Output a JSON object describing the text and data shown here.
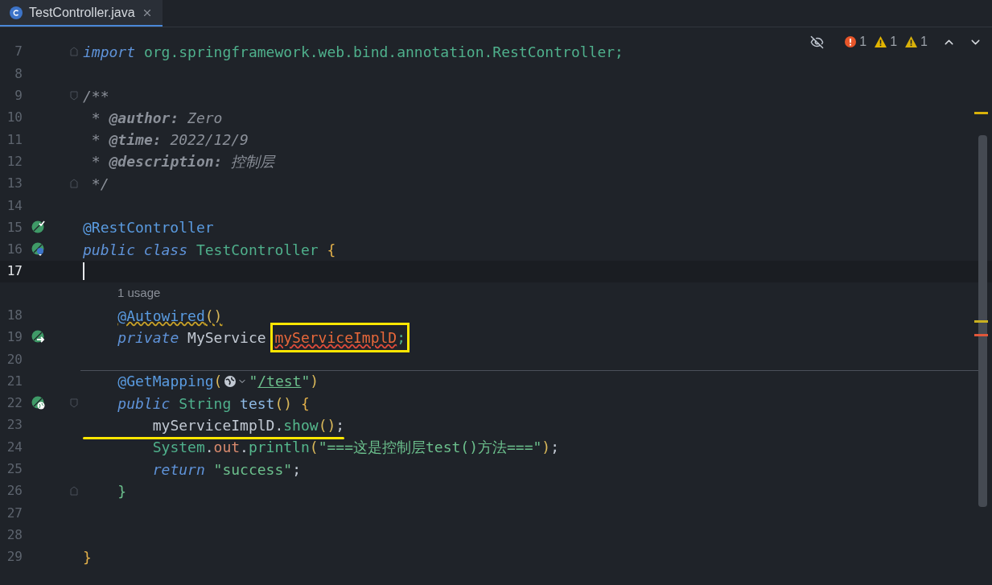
{
  "tabs": [
    {
      "title": "TestController.java",
      "selected": true
    }
  ],
  "inspections": {
    "errors": "1",
    "warnings": "1",
    "weak_warnings": "1"
  },
  "lines": [
    {
      "number": "7",
      "current": false,
      "fold_close": true,
      "tokens": [
        {
          "kind": "keyword",
          "text": "import"
        },
        {
          "kind": "package",
          "text": " org.springframework.web.bind.annotation.RestController;"
        }
      ]
    },
    {
      "number": "8",
      "current": false
    },
    {
      "number": "9",
      "current": false,
      "fold_open": true,
      "tokens": [
        {
          "kind": "comment",
          "text": "/**"
        }
      ]
    },
    {
      "number": "10",
      "current": false,
      "tokens": [
        {
          "kind": "comment",
          "text": " *"
        },
        {
          "kind": "doctag",
          "text": " @author:"
        },
        {
          "kind": "comment",
          "text": " Zero"
        }
      ]
    },
    {
      "number": "11",
      "current": false,
      "tokens": [
        {
          "kind": "comment",
          "text": " *"
        },
        {
          "kind": "doctag",
          "text": " @time:"
        },
        {
          "kind": "comment",
          "text": " 2022/12/9"
        }
      ]
    },
    {
      "number": "12",
      "current": false,
      "tokens": [
        {
          "kind": "comment",
          "text": " *"
        },
        {
          "kind": "doctag",
          "text": " @description:"
        },
        {
          "kind": "comment",
          "text": " 控制层"
        }
      ]
    },
    {
      "number": "13",
      "current": false,
      "fold_close": true,
      "tokens": [
        {
          "kind": "comment",
          "text": " */"
        }
      ]
    },
    {
      "number": "14",
      "current": false
    },
    {
      "number": "15",
      "current": false,
      "gutter": {
        "kind": "bean-check"
      },
      "tokens": [
        {
          "kind": "annotation",
          "text": "@RestController"
        }
      ]
    },
    {
      "number": "16",
      "current": false,
      "gutter": {
        "kind": "bean-down"
      },
      "tokens": [
        {
          "kind": "keyword",
          "text": "public class"
        },
        {
          "kind": "type",
          "text": " TestController"
        },
        {
          "kind": "brace",
          "text": " {"
        }
      ]
    },
    {
      "number": "17",
      "current": true
    },
    {
      "inlay": "1 usage",
      "number": "18",
      "current": false,
      "tokens": [
        {
          "kind": "annotation-warn",
          "text": "    @Autowired"
        },
        {
          "kind": "paren-warn",
          "text": "()"
        }
      ]
    },
    {
      "number": "19",
      "current": false,
      "gutter": {
        "kind": "bean-arrow"
      },
      "tokens": [
        {
          "kind": "keyword",
          "text": "    private"
        },
        {
          "kind": "plain",
          "text": " MyService "
        },
        {
          "kind": "boxed",
          "tokens": [
            {
              "kind": "field-error",
              "text": "myServiceImplD"
            },
            {
              "kind": "package",
              "text": ";"
            }
          ]
        }
      ]
    },
    {
      "number": "20",
      "current": false
    },
    {
      "number": "21",
      "current": false,
      "separator": true,
      "tokens": [
        {
          "kind": "annotation",
          "text": "    @GetMapping"
        },
        {
          "kind": "paren",
          "text": "("
        },
        {
          "kind": "globe"
        },
        {
          "kind": "string",
          "text": "\""
        },
        {
          "kind": "string-link",
          "text": "/test"
        },
        {
          "kind": "string",
          "text": "\""
        },
        {
          "kind": "paren",
          "text": ")"
        }
      ]
    },
    {
      "number": "22",
      "current": false,
      "fold_open": true,
      "gutter": {
        "kind": "globe"
      },
      "tokens": [
        {
          "kind": "keyword",
          "text": "    public"
        },
        {
          "kind": "type",
          "text": " String"
        },
        {
          "kind": "method",
          "text": " test"
        },
        {
          "kind": "paren",
          "text": "()"
        },
        {
          "kind": "brace",
          "text": " {"
        }
      ]
    },
    {
      "number": "23",
      "current": false,
      "tokens": [
        {
          "kind": "underlined",
          "tokens": [
            {
              "kind": "plain",
              "text": "        myServiceImplD."
            },
            {
              "kind": "call",
              "text": "show"
            },
            {
              "kind": "paren",
              "text": "()"
            },
            {
              "kind": "plain",
              "text": ";"
            }
          ]
        }
      ]
    },
    {
      "number": "24",
      "current": false,
      "tokens": [
        {
          "kind": "type",
          "text": "        System"
        },
        {
          "kind": "plain",
          "text": "."
        },
        {
          "kind": "field",
          "text": "out"
        },
        {
          "kind": "plain",
          "text": "."
        },
        {
          "kind": "call",
          "text": "println"
        },
        {
          "kind": "paren",
          "text": "("
        },
        {
          "kind": "string",
          "text": "\"===这是控制层test()方法===\""
        },
        {
          "kind": "paren",
          "text": ")"
        },
        {
          "kind": "plain",
          "text": ";"
        }
      ]
    },
    {
      "number": "25",
      "current": false,
      "tokens": [
        {
          "kind": "keyword",
          "text": "        return"
        },
        {
          "kind": "string",
          "text": " \"success\""
        },
        {
          "kind": "plain",
          "text": ";"
        }
      ]
    },
    {
      "number": "26",
      "current": false,
      "fold_close": true,
      "tokens": [
        {
          "kind": "brace-inner",
          "text": "    }"
        }
      ]
    },
    {
      "number": "27",
      "current": false
    },
    {
      "number": "28",
      "current": false
    },
    {
      "number": "29",
      "current": false,
      "tokens": [
        {
          "kind": "brace",
          "text": "}"
        }
      ]
    }
  ]
}
